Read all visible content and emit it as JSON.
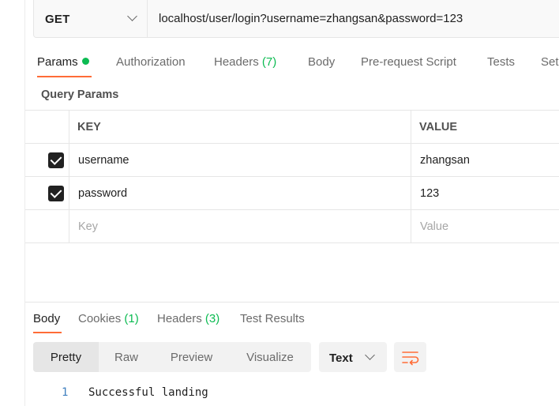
{
  "request": {
    "method": "GET",
    "url": "localhost/user/login?username=zhangsan&password=123"
  },
  "request_tabs": [
    {
      "label": "Params",
      "active": true,
      "has_dot": true
    },
    {
      "label": "Authorization"
    },
    {
      "label": "Headers",
      "count": "(7)"
    },
    {
      "label": "Body"
    },
    {
      "label": "Pre-request Script"
    },
    {
      "label": "Tests"
    },
    {
      "label": "Set"
    }
  ],
  "query_params": {
    "title": "Query Params",
    "columns": {
      "key": "KEY",
      "value": "VALUE"
    },
    "rows": [
      {
        "key": "username",
        "value": "zhangsan",
        "checked": true
      },
      {
        "key": "password",
        "value": "123",
        "checked": true
      }
    ],
    "empty_row": {
      "key_placeholder": "Key",
      "value_placeholder": "Value"
    }
  },
  "response_tabs": [
    {
      "label": "Body",
      "active": true
    },
    {
      "label": "Cookies",
      "count": "(1)"
    },
    {
      "label": "Headers",
      "count": "(3)"
    },
    {
      "label": "Test Results"
    }
  ],
  "response_toolbar": {
    "views": [
      "Pretty",
      "Raw",
      "Preview",
      "Visualize"
    ],
    "active_view": "Pretty",
    "format": "Text",
    "wrap_icon": "wrap-lines-icon"
  },
  "response_body": {
    "line_number": "1",
    "text": "Successful landing"
  },
  "colors": {
    "accent": "#ff6c37",
    "success": "#0cbb52"
  }
}
